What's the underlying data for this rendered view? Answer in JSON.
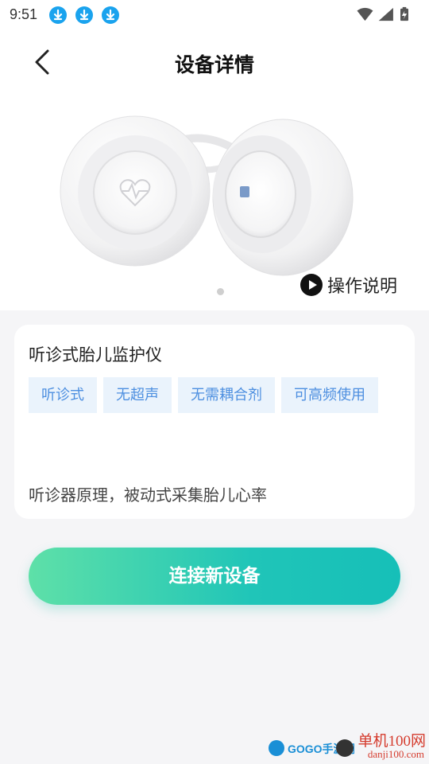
{
  "status_bar": {
    "time": "9:51",
    "icons": [
      "download-icon",
      "download-icon",
      "download-icon",
      "wifi-icon",
      "signal-icon",
      "battery-charging-icon"
    ]
  },
  "header": {
    "title": "设备详情",
    "back_icon": "chevron-left-icon"
  },
  "carousel": {
    "guide_label": "操作说明",
    "guide_icon": "play-circle-icon",
    "page_count": 1,
    "current_page": 1
  },
  "device_card": {
    "name": "听诊式胎儿监护仪",
    "tags": [
      "听诊式",
      "无超声",
      "无需耦合剂",
      "可高频使用"
    ],
    "description": "听诊器原理，被动式采集胎儿心率"
  },
  "connect_button": {
    "label": "连接新设备"
  },
  "watermark": {
    "logo_text": "GOGO手游网",
    "site_name": "单机100网",
    "site_url": "danji100.com"
  },
  "colors": {
    "accent_gradient_start": "#5ee0a8",
    "accent_gradient_end": "#16bfb8",
    "tag_bg": "#eaf3fc",
    "tag_text": "#4d8fe0",
    "download_icon": "#1aa3ee"
  }
}
